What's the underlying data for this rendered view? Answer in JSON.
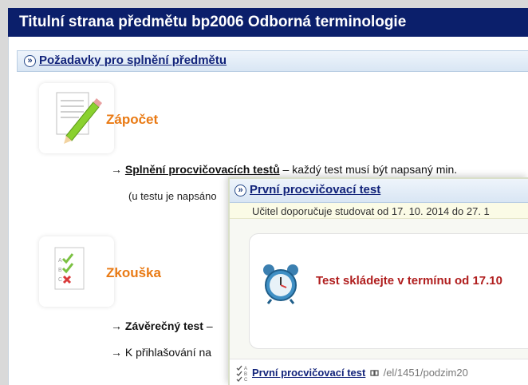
{
  "page_title": "Titulní strana předmětu bp2006 Odborná terminologie",
  "section": {
    "title": "Požadavky pro splnění předmětu",
    "expand_glyph": "»"
  },
  "zapocet": {
    "heading": "Zápočet",
    "arrow": "→",
    "req_bold": "Splnění procvičovacích testů",
    "req_rest": " – každý test musí být napsaný min.",
    "note": "(u testu je napsáno"
  },
  "zkouska": {
    "heading": "Zkouška",
    "line1_bold": "Závěrečný test",
    "line1_rest": " –",
    "line2": "K přihlašování na"
  },
  "popup": {
    "title": "První procvičovací test",
    "teacher_note": "Učitel doporučuje studovat od 17. 10. 2014 do 27. 1",
    "warning": "Test skládejte v termínu od 17.10",
    "footer_link": "První procvičovací test",
    "footer_path": "/el/1451/podzim20"
  },
  "icons": [
    "expand-icon",
    "pencil-note-icon",
    "checklist-icon",
    "alarm-clock-icon",
    "quiz-abc-icon",
    "link-icon"
  ],
  "colors": {
    "title_bar": "#0b1f6b",
    "heading_orange": "#e97a14",
    "warning_red": "#b01e1e",
    "link_blue": "#12237a"
  }
}
